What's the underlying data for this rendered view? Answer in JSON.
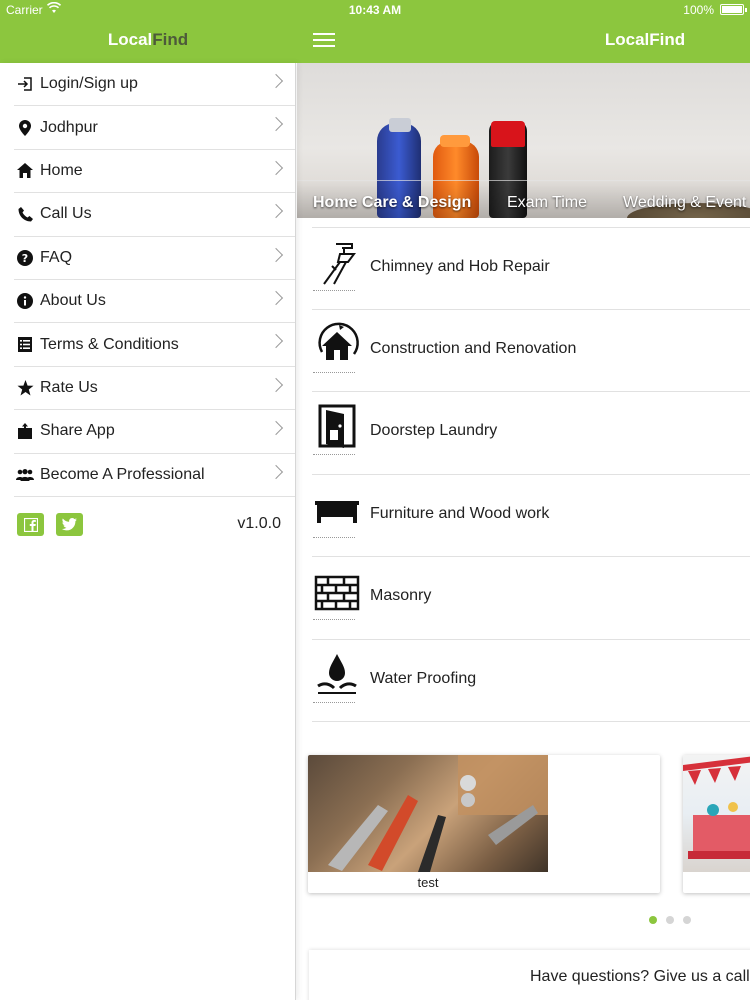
{
  "status_bar": {
    "carrier": "Carrier",
    "time": "10:43 AM",
    "battery": "100%"
  },
  "app": {
    "name_part1": "Local",
    "name_part2": "Find"
  },
  "colors": {
    "brand_green": "#8cc63e",
    "brand_dark": "#4d5a3a"
  },
  "sidebar": {
    "items": [
      {
        "label": "Login/Sign up",
        "icon": "login-icon"
      },
      {
        "label": "Jodhpur",
        "icon": "location-pin-icon"
      },
      {
        "label": "Home",
        "icon": "home-icon"
      },
      {
        "label": "Call Us",
        "icon": "phone-icon"
      },
      {
        "label": "FAQ",
        "icon": "question-icon"
      },
      {
        "label": "About Us",
        "icon": "info-icon"
      },
      {
        "label": "Terms & Conditions",
        "icon": "list-icon"
      },
      {
        "label": "Rate Us",
        "icon": "star-icon"
      },
      {
        "label": "Share App",
        "icon": "share-icon"
      },
      {
        "label": "Become A Professional",
        "icon": "users-icon"
      }
    ],
    "version": "v1.0.0",
    "social": [
      "facebook-icon",
      "twitter-icon"
    ]
  },
  "banner": {
    "tabs": [
      "Home Care & Design",
      "Exam Time",
      "Wedding & Event"
    ],
    "active_tab": "Home Care & Design"
  },
  "services": [
    {
      "name": "Chimney and Hob Repair",
      "icon": "chimney-icon"
    },
    {
      "name": "Construction and Renovation",
      "icon": "house-icon"
    },
    {
      "name": "Doorstep Laundry",
      "icon": "door-icon"
    },
    {
      "name": "Furniture and Wood work",
      "icon": "table-icon"
    },
    {
      "name": "Masonry",
      "icon": "brick-wall-icon"
    },
    {
      "name": "Water Proofing",
      "icon": "water-drop-icon"
    }
  ],
  "cards": [
    {
      "caption": "test"
    }
  ],
  "pager": {
    "count": 3,
    "active_index": 0
  },
  "help": {
    "text": "Have questions? Give us a call"
  }
}
